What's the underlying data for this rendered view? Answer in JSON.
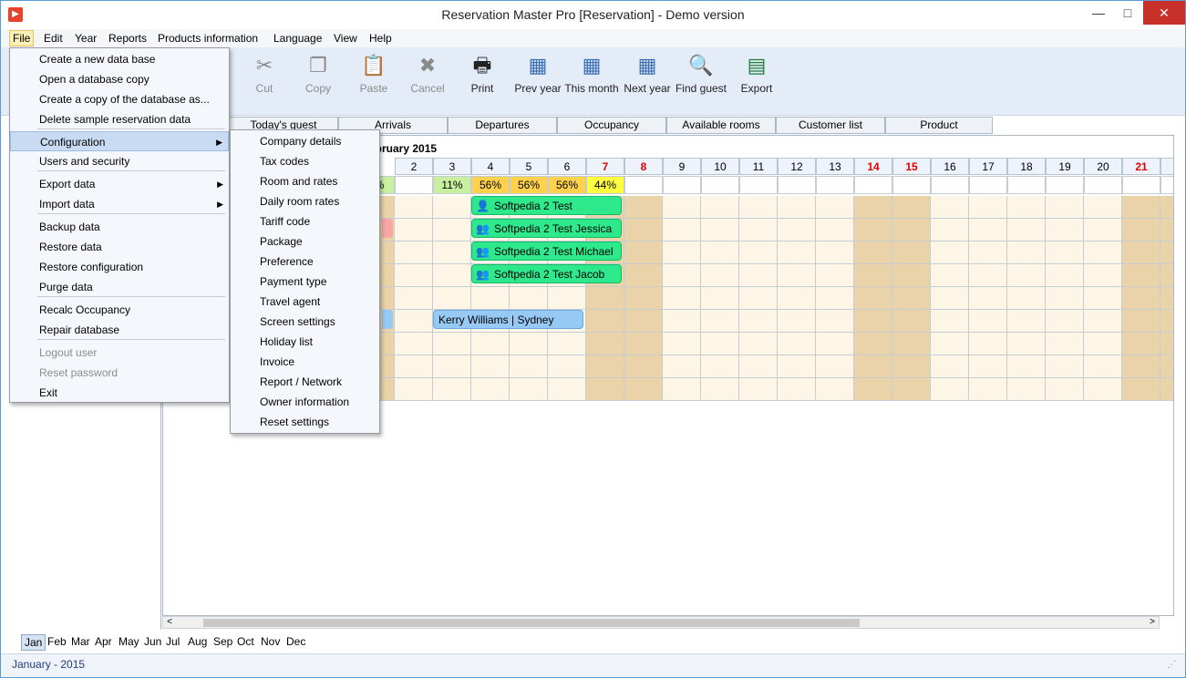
{
  "window": {
    "title": "Reservation Master Pro [Reservation] - Demo version"
  },
  "menubar": [
    "File",
    "Edit",
    "Year",
    "Reports",
    "Products information",
    "Language",
    "View",
    "Help"
  ],
  "toolbar": [
    {
      "label": "Cut",
      "icon": "scissors-icon",
      "enabled": false
    },
    {
      "label": "Copy",
      "icon": "copy-icon",
      "enabled": false
    },
    {
      "label": "Paste",
      "icon": "paste-icon",
      "enabled": false
    },
    {
      "label": "Cancel",
      "icon": "cancel-icon",
      "enabled": false
    },
    {
      "label": "Print",
      "icon": "printer-icon",
      "enabled": true
    },
    {
      "label": "Prev year",
      "icon": "calendar-prev-icon",
      "enabled": true
    },
    {
      "label": "This month",
      "icon": "calendar-today-icon",
      "enabled": true
    },
    {
      "label": "Next year",
      "icon": "calendar-next-icon",
      "enabled": true
    },
    {
      "label": "Find guest",
      "icon": "magnifier-icon",
      "enabled": true
    },
    {
      "label": "Export",
      "icon": "excel-icon",
      "enabled": true
    }
  ],
  "tabs": [
    "Today's guest",
    "Arrivals",
    "Departures",
    "Occupancy",
    "Available rooms",
    "Customer list",
    "Product"
  ],
  "calendar": {
    "month_title": "ebruary 2015",
    "days": [
      "2",
      "3",
      "4",
      "5",
      "6",
      "7",
      "8",
      "9",
      "10",
      "11",
      "12",
      "13",
      "14",
      "15",
      "16",
      "17",
      "18",
      "19",
      "20",
      "21",
      "2"
    ],
    "occupancy": {
      "first_partial": "%",
      "values": [
        "",
        "11%",
        "56%",
        "56%",
        "56%",
        "44%"
      ]
    },
    "reservations": [
      {
        "label": "Softpedia 2 Test",
        "type": "single"
      },
      {
        "label": "Softpedia 2 Test Jessica",
        "type": "group"
      },
      {
        "label": "Softpedia 2 Test Michael",
        "type": "group"
      },
      {
        "label": "Softpedia 2 Test Jacob",
        "type": "group"
      },
      {
        "label": "Kerry Williams | Sydney",
        "type": "plain"
      }
    ]
  },
  "months": [
    "Jan",
    "Feb",
    "Mar",
    "Apr",
    "May",
    "Jun",
    "Jul",
    "Aug",
    "Sep",
    "Oct",
    "Nov",
    "Dec"
  ],
  "status": {
    "text": "January - 2015"
  },
  "file_menu": [
    {
      "label": "Create a new data base"
    },
    {
      "label": "Open a database copy"
    },
    {
      "label": "Create a copy of the database as..."
    },
    {
      "label": "Delete sample reservation data"
    },
    {
      "label": "Configuration",
      "submenu": true,
      "highlighted": true
    },
    {
      "label": "Users and security"
    },
    {
      "label": "Export data",
      "submenu": true
    },
    {
      "label": "Import data",
      "submenu": true
    },
    {
      "label": "Backup data"
    },
    {
      "label": "Restore data"
    },
    {
      "label": "Restore configuration"
    },
    {
      "label": "Purge data"
    },
    {
      "label": "Recalc Occupancy"
    },
    {
      "label": "Repair database"
    },
    {
      "label": "Logout user",
      "disabled": true
    },
    {
      "label": "Reset password",
      "disabled": true
    },
    {
      "label": "Exit"
    }
  ],
  "config_menu": [
    "Company details",
    "Tax codes",
    "Room and rates",
    "Daily room rates",
    "Tariff code",
    "Package",
    "Preference",
    "Payment type",
    "Travel agent",
    "Screen settings",
    "Holiday list",
    "Invoice",
    "Report / Network",
    "Owner information",
    "Reset settings"
  ]
}
